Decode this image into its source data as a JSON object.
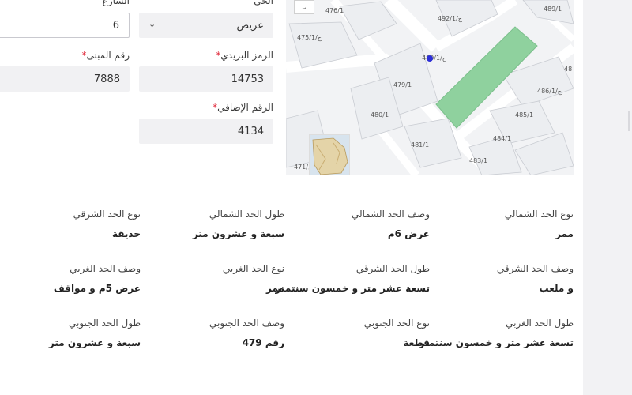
{
  "form": {
    "street_label": "الشارع",
    "street_value": "6",
    "district_label": "الحي",
    "district_value": "عريض",
    "postal_label": "الرمز البريدي",
    "postal_value": "14753",
    "building_label": "رقم المبنى",
    "building_value": "7888",
    "additional_label": "الرقم الإضافي",
    "additional_value": "4134",
    "required_mark": "*"
  },
  "map": {
    "plot_labels": [
      "476/1",
      "ح/475/1",
      "ح/492/1",
      "489/1",
      "479/1",
      "ح/486/1",
      "48",
      "480/1",
      "485/1",
      "481/1",
      "484/1",
      "483/1",
      "ح/471"
    ],
    "selected_plot_label": "ح/480/1",
    "highlight_color": "#8fd19e",
    "marker_color": "#2d2fd6",
    "controls": [
      "chevron-down-icon"
    ]
  },
  "boundaries": [
    {
      "label": "نوع الحد الشمالي",
      "value": "ممر"
    },
    {
      "label": "وصف الحد الشمالي",
      "value": "عرض 6م"
    },
    {
      "label": "طول الحد الشمالي",
      "value": "سبعة و عشرون متر"
    },
    {
      "label": "نوع الحد الشرقي",
      "value": "حديقة"
    },
    {
      "label": "وصف الحد الشرقي",
      "value": "و ملعب"
    },
    {
      "label": "طول الحد الشرقي",
      "value": "تسعة عشر متر و خمسون سنتمتر"
    },
    {
      "label": "نوع الحد الغربي",
      "value": "ممر"
    },
    {
      "label": "وصف الحد الغربي",
      "value": "عرض 5م و مواقف"
    },
    {
      "label": "طول الحد الغربي",
      "value": "تسعة عشر متر و خمسون سنتمتر"
    },
    {
      "label": "نوع الحد الجنوبي",
      "value": "قطعة"
    },
    {
      "label": "وصف الحد الجنوبي",
      "value": "رقم 479"
    },
    {
      "label": "طول الحد الجنوبي",
      "value": "سبعة و عشرون متر"
    }
  ]
}
